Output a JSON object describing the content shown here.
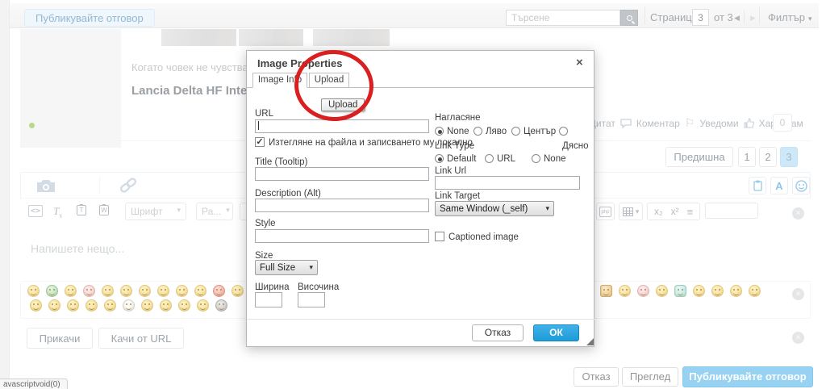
{
  "icons": {
    "caret": "▾",
    "prev_arrow": "◀",
    "next_arrow": "▶",
    "close": "×",
    "quote": "”",
    "flag": "⚐",
    "undo": "↶",
    "lines": "≡",
    "source": "<>",
    "remove_format_T": "T",
    "remove_format_x": "x",
    "paste_text": "T",
    "paste_word": "W",
    "php": "php",
    "check": "✓"
  },
  "header": {
    "reply_button": "Публикувайте отговор",
    "search_placeholder": "Търсене",
    "page_label": "Страница",
    "page_value": "3",
    "page_of": "от 3",
    "filter_label": "Филтър"
  },
  "post": {
    "text_preview": "Когато човек не чувства",
    "title_preview": "Lancia Delta HF Integra",
    "actions": {
      "quote": "Цитат",
      "comment": "Коментар",
      "notify": "Уведоми",
      "like": "Харесвам",
      "like_count": "0"
    }
  },
  "pagination": {
    "prev": "Предишна",
    "pages": [
      "1",
      "2",
      "3"
    ],
    "active_page": "3"
  },
  "editor": {
    "placeholder": "Напишете нещо...",
    "font_dropdown": "Шрифт",
    "size_dropdown": "Ра...",
    "color_button": "A",
    "subscript": "x₂",
    "superscript": "x²",
    "attach_button": "Прикачи",
    "upload_url_button": "Качи от URL"
  },
  "emoticons": {
    "row1_left": [
      {
        "n": "idea",
        "v": "yellow"
      },
      {
        "n": "green-grin",
        "v": "green"
      },
      {
        "n": "question",
        "v": "yellow"
      },
      {
        "n": "blush",
        "v": "pink"
      },
      {
        "n": "arrow",
        "v": "yellow"
      },
      {
        "n": "smile",
        "v": "yellow"
      },
      {
        "n": "neutral",
        "v": "yellow"
      },
      {
        "n": "cry",
        "v": "yellow"
      },
      {
        "n": "smirk",
        "v": "yellow"
      },
      {
        "n": "wink",
        "v": "yellow"
      },
      {
        "n": "mad",
        "v": "red"
      },
      {
        "n": "tongue",
        "v": "yellow"
      }
    ],
    "row2_left": [
      {
        "n": "sad",
        "v": "yellow"
      },
      {
        "n": "razz",
        "v": "yellow"
      },
      {
        "n": "tongue-smile",
        "v": "yellow"
      },
      {
        "n": "crazy",
        "v": "yellow"
      },
      {
        "n": "wacko",
        "v": "yellow"
      },
      {
        "n": "pale",
        "v": "white"
      },
      {
        "n": "angry",
        "v": "yellow"
      },
      {
        "n": "upset",
        "v": "yellow"
      },
      {
        "n": "wink2",
        "v": "yellow"
      },
      {
        "n": "laugh",
        "v": "yellow"
      },
      {
        "n": "afro",
        "v": "gray"
      }
    ],
    "row1_right": [
      {
        "n": "beer",
        "v": "amber"
      },
      {
        "n": "razz-wink",
        "v": "yellow"
      },
      {
        "n": "in-love",
        "v": "pink"
      },
      {
        "n": "big-laugh",
        "v": "yellow"
      },
      {
        "n": "clover",
        "v": "teal"
      },
      {
        "n": "devil",
        "v": "yellow"
      },
      {
        "n": "grin",
        "v": "yellow"
      },
      {
        "n": "bulb",
        "v": "yellow"
      },
      {
        "n": "sneeze",
        "v": "yellow"
      }
    ]
  },
  "dialog": {
    "title": "Image Properties",
    "tabs": [
      "Image Info",
      "Upload"
    ],
    "upload_button": "Upload",
    "url_label": "URL",
    "download_checkbox_label": "Изтегляне на файла и записването му локално",
    "title_label": "Title (Tooltip)",
    "description_label": "Description (Alt)",
    "style_label": "Style",
    "size_label": "Size",
    "size_value": "Full Size",
    "width_label": "Ширина",
    "height_label": "Височина",
    "align_label": "Нагласяне",
    "align_options": [
      "None",
      "Ляво",
      "Център",
      "Дясно"
    ],
    "align_selected": "None",
    "link_type_label": "Link Type",
    "link_type_options": [
      "Default",
      "URL",
      "None"
    ],
    "link_type_selected": "Default",
    "link_url_label": "Link Url",
    "link_target_label": "Link Target",
    "link_target_value": "Same Window (_self)",
    "captioned_label": "Captioned image",
    "cancel_button": "Отказ",
    "ok_button": "ОК"
  },
  "footer": {
    "cancel": "Отказ",
    "preview": "Преглед",
    "submit": "Публикувайте отговор"
  },
  "statusbar": {
    "link_hint": "avascriptvoid(0)"
  }
}
